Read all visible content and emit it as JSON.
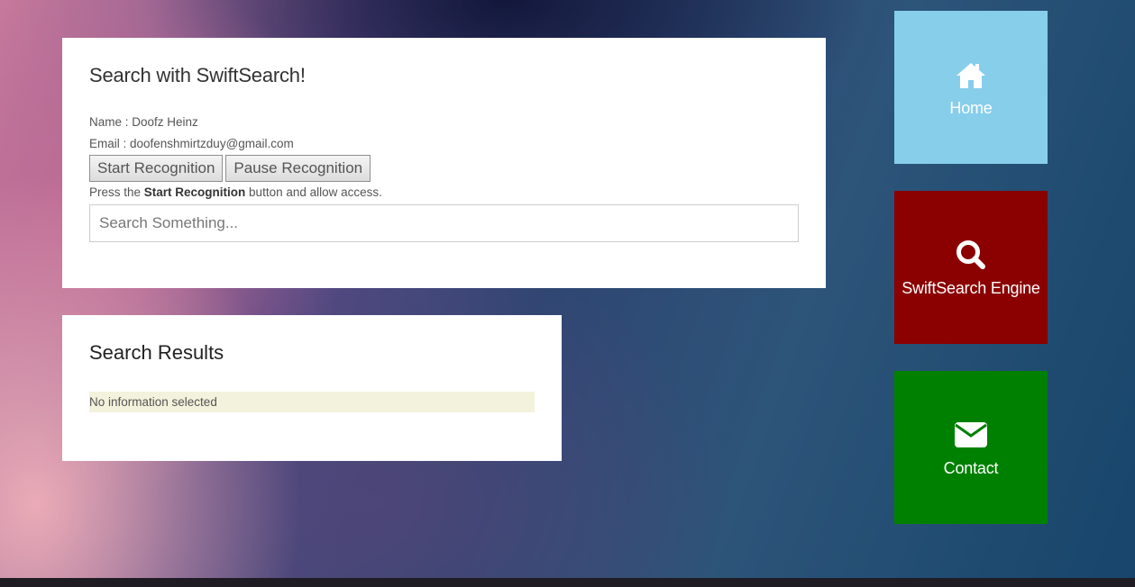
{
  "search_panel": {
    "title": "Search with SwiftSearch!",
    "name_line": "Name : Doofz Heinz",
    "email_line": "Email : doofenshmirtzduy@gmail.com",
    "start_button": "Start Recognition",
    "pause_button": "Pause Recognition",
    "hint_prefix": "Press the ",
    "hint_bold": "Start Recognition",
    "hint_suffix": " button and allow access.",
    "input_value": "",
    "input_placeholder": "Search Something..."
  },
  "results_panel": {
    "title": "Search Results",
    "empty_text": "No information selected"
  },
  "nav_tiles": [
    {
      "label": "Home",
      "icon": "home-icon",
      "color": "#87ceeb"
    },
    {
      "label": "SwiftSearch Engine",
      "icon": "search-icon",
      "color": "#8b0000"
    },
    {
      "label": "Contact",
      "icon": "envelope-icon",
      "color": "#008000"
    }
  ]
}
